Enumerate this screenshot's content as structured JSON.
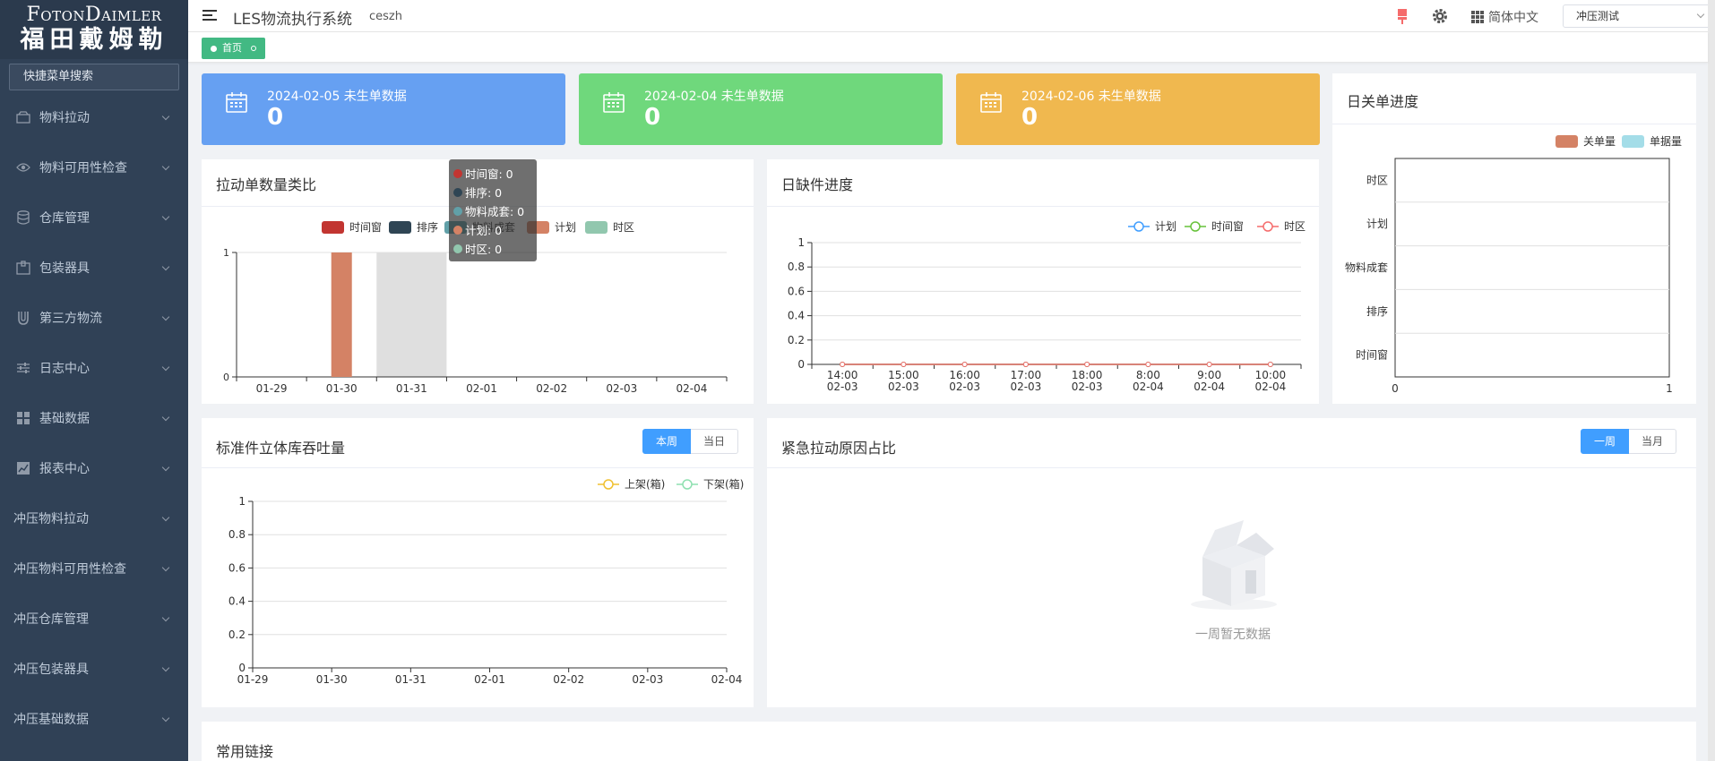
{
  "logo": {
    "en": "FotonDaimler",
    "cn": "福田戴姆勒"
  },
  "sidebar": {
    "search_label": "快捷菜单搜索",
    "items": [
      {
        "label": "物料拉动",
        "icon": "box-icon"
      },
      {
        "label": "物料可用性检查",
        "icon": "eye-icon"
      },
      {
        "label": "仓库管理",
        "icon": "database-icon"
      },
      {
        "label": "包装器具",
        "icon": "package-icon"
      },
      {
        "label": "第三方物流",
        "icon": "magnet-icon"
      },
      {
        "label": "日志中心",
        "icon": "sliders-icon"
      },
      {
        "label": "基础数据",
        "icon": "grid-icon"
      },
      {
        "label": "报表中心",
        "icon": "chart-icon"
      },
      {
        "label": "冲压物料拉动",
        "icon": ""
      },
      {
        "label": "冲压物料可用性检查",
        "icon": ""
      },
      {
        "label": "冲压仓库管理",
        "icon": ""
      },
      {
        "label": "冲压包装器具",
        "icon": ""
      },
      {
        "label": "冲压基础数据",
        "icon": ""
      }
    ]
  },
  "header": {
    "title": "LES物流执行系统",
    "user": "ceszh",
    "language": "简体中文",
    "select_value": "冲压测试"
  },
  "tags": {
    "home": "首页"
  },
  "stats": [
    {
      "label": "2024-02-05 未生单数据",
      "value": "0",
      "color": "#66a0f2"
    },
    {
      "label": "2024-02-04 未生单数据",
      "value": "0",
      "color": "#6fd87c"
    },
    {
      "label": "2024-02-06 未生单数据",
      "value": "0",
      "color": "#f0b84f"
    }
  ],
  "pull_chart": {
    "title": "拉动单数量类比",
    "legend": [
      "时间窗",
      "排序",
      "物料成套",
      "计划",
      "时区"
    ],
    "colors": [
      "#c23531",
      "#2f4554",
      "#61a0a8",
      "#d48265",
      "#91c7ae"
    ],
    "tooltip": [
      "时间窗: 0",
      "排序: 0",
      "物料成套: 0",
      "计划: 0",
      "时区: 0"
    ]
  },
  "shortage_chart": {
    "title": "日缺件进度",
    "legend": [
      "计划",
      "时间窗",
      "时区"
    ],
    "colors": [
      "#409eff",
      "#67c23a",
      "#f56c6c"
    ]
  },
  "close_chart": {
    "title": "日关单进度",
    "legend": [
      "关单量",
      "单据量"
    ],
    "colors": [
      "#d48265",
      "#a4dde8"
    ]
  },
  "throughput_chart": {
    "title": "标准件立体库吞吐量",
    "btn_week": "本周",
    "btn_day": "当日",
    "legend": [
      "上架(箱)",
      "下架(箱)"
    ],
    "colors": [
      "#f0c030",
      "#8ee0b0"
    ]
  },
  "urgent_chart": {
    "title": "紧急拉动原因占比",
    "btn_week": "一周",
    "btn_month": "当月",
    "empty_text": "一周暂无数据"
  },
  "links": {
    "title": "常用链接"
  },
  "chart_data": [
    {
      "type": "bar",
      "title": "拉动单数量类比",
      "categories": [
        "01-29",
        "01-30",
        "01-31",
        "02-01",
        "02-02",
        "02-03",
        "02-04"
      ],
      "series": [
        {
          "name": "时间窗",
          "values": [
            0,
            0,
            0,
            0,
            0,
            0,
            0
          ]
        },
        {
          "name": "排序",
          "values": [
            0,
            0,
            0,
            0,
            0,
            0,
            0
          ]
        },
        {
          "name": "物料成套",
          "values": [
            0,
            0,
            0,
            0,
            0,
            0,
            0
          ]
        },
        {
          "name": "计划",
          "values": [
            0,
            1,
            0,
            0,
            0,
            0,
            0
          ]
        },
        {
          "name": "时区",
          "values": [
            0,
            0,
            0,
            0,
            0,
            0,
            0
          ]
        }
      ],
      "ylim": [
        0,
        1
      ],
      "yticks": [
        "0",
        "1"
      ],
      "highlight_category": "01-31",
      "legend": "top-center"
    },
    {
      "type": "line",
      "title": "日缺件进度",
      "x": [
        "14:00\n02-03",
        "15:00\n02-03",
        "16:00\n02-03",
        "17:00\n02-03",
        "18:00\n02-03",
        "8:00\n02-04",
        "9:00\n02-04",
        "10:00\n02-04"
      ],
      "series": [
        {
          "name": "计划",
          "values": [
            0,
            0,
            0,
            0,
            0,
            0,
            0,
            0
          ]
        },
        {
          "name": "时间窗",
          "values": [
            0,
            0,
            0,
            0,
            0,
            0,
            0,
            0
          ]
        },
        {
          "name": "时区",
          "values": [
            0,
            0,
            0,
            0,
            0,
            0,
            0,
            0
          ]
        }
      ],
      "ylim": [
        0,
        1
      ],
      "yticks": [
        "0",
        "0.2",
        "0.4",
        "0.6",
        "0.8",
        "1"
      ],
      "legend": "top-right"
    },
    {
      "type": "bar",
      "title": "日关单进度",
      "orientation": "horizontal",
      "categories": [
        "时间窗",
        "排序",
        "物料成套",
        "计划",
        "时区"
      ],
      "series": [
        {
          "name": "关单量",
          "values": [
            0,
            0,
            0,
            0,
            0
          ]
        },
        {
          "name": "单据量",
          "values": [
            0,
            0,
            0,
            0,
            0
          ]
        }
      ],
      "xlim": [
        0,
        1
      ],
      "xticks": [
        "0",
        "1"
      ],
      "legend": "top-right"
    },
    {
      "type": "line",
      "title": "标准件立体库吞吐量",
      "x": [
        "01-29",
        "01-30",
        "01-31",
        "02-01",
        "02-02",
        "02-03",
        "02-04"
      ],
      "series": [
        {
          "name": "上架(箱)",
          "values": []
        },
        {
          "name": "下架(箱)",
          "values": []
        }
      ],
      "ylim": [
        0,
        1
      ],
      "yticks": [
        "0",
        "0.2",
        "0.4",
        "0.6",
        "0.8",
        "1"
      ],
      "legend": "top-right"
    }
  ]
}
